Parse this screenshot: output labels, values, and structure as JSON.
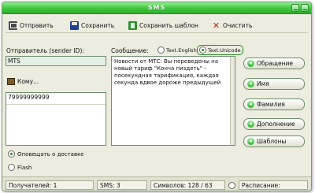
{
  "window": {
    "title": "SMS"
  },
  "toolbar": {
    "send_label": "Отправить",
    "save_label": "Сохранить",
    "save_template_label": "Сохранить шаблон",
    "clear_label": "Очистить"
  },
  "sender": {
    "label": "Отправитель (sender ID):",
    "value": "MTS"
  },
  "recipients": {
    "button_label": "Кому...",
    "value": "79999999999"
  },
  "message": {
    "label": "Сообщение:",
    "text": "Новости от МТС: Вы переведены на новый тариф \"Конча пиздеть\" - посекундная тарификация, каждая секунда вдвое дороже предыдущей",
    "encoding_options": [
      "Text.English",
      "Text.Unicode"
    ],
    "encoding_selected": "Text.Unicode"
  },
  "side_buttons": [
    "Обращение",
    "Имя",
    "Фамилия",
    "Дополнение",
    "Шаблоны"
  ],
  "options": {
    "delivery_notify_label": "Оповещать о доставке",
    "delivery_notify": true,
    "flash_label": "Flash",
    "flash": false
  },
  "status": {
    "recipients": "Получателей: 1",
    "sms": "SMS: 3",
    "symbols": "Символов: 128 / 63",
    "schedule": "Расписание:"
  },
  "colors": {
    "accent": "#3ec63e",
    "title_text": "#ffffff"
  }
}
